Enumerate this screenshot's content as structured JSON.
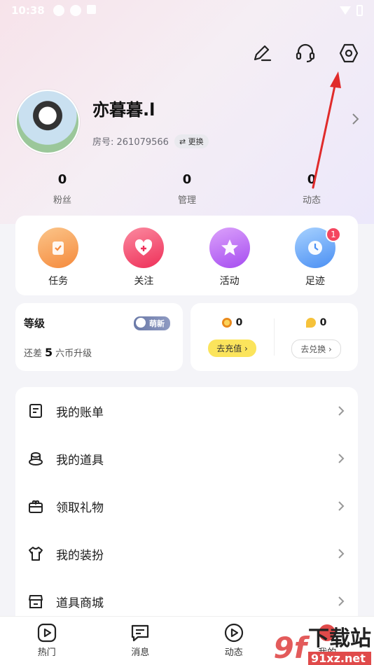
{
  "status_bar": {
    "time": "10:38"
  },
  "profile": {
    "name": "亦暮暮.l",
    "room_label": "房号: 261079566",
    "swap_label": "⇄ 更换"
  },
  "stats": [
    {
      "value": "0",
      "label": "粉丝"
    },
    {
      "value": "0",
      "label": "管理"
    },
    {
      "value": "0",
      "label": "动态"
    }
  ],
  "quick_actions": [
    {
      "label": "任务",
      "color": "#f8a34e",
      "icon": "task-icon"
    },
    {
      "label": "关注",
      "color": "#f34d6b",
      "icon": "heart-icon"
    },
    {
      "label": "活动",
      "color": "#b061f2",
      "icon": "star-icon"
    },
    {
      "label": "足迹",
      "color": "#4f9cf6",
      "icon": "clock-icon",
      "badge": "1"
    }
  ],
  "level": {
    "title": "等级",
    "badge": "萌新",
    "prefix": "还差",
    "amount": "5",
    "suffix": "六币升级"
  },
  "wallet": {
    "coin_a": "0",
    "coin_b": "0",
    "recharge_label": "去充值 ›",
    "exchange_label": "去兑换 ›"
  },
  "menu": [
    {
      "label": "我的账单",
      "icon": "receipt-icon"
    },
    {
      "label": "我的道具",
      "icon": "hat-icon"
    },
    {
      "label": "领取礼物",
      "icon": "gift-icon"
    },
    {
      "label": "我的装扮",
      "icon": "shirt-icon"
    },
    {
      "label": "道具商城",
      "icon": "store-icon"
    }
  ],
  "tabs": [
    {
      "label": "热门",
      "icon": "play-tab-icon"
    },
    {
      "label": "消息",
      "icon": "message-icon"
    },
    {
      "label": "动态",
      "icon": "feed-icon"
    },
    {
      "label": "我的",
      "icon": "profile-icon"
    }
  ],
  "watermark": {
    "logo": "9f",
    "cn": "下载站",
    "url": "91xz.net"
  }
}
